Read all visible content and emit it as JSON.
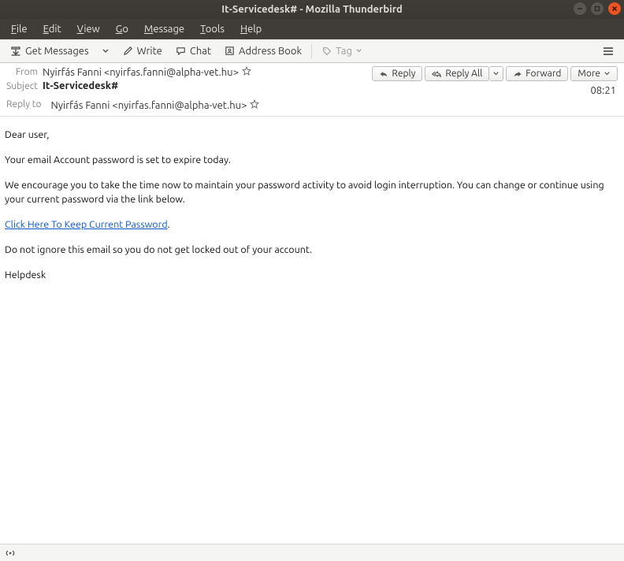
{
  "window": {
    "title": "It-Servicedesk# - Mozilla Thunderbird"
  },
  "menu": {
    "file": "File",
    "edit": "Edit",
    "view": "View",
    "go": "Go",
    "message": "Message",
    "tools": "Tools",
    "help": "Help"
  },
  "toolbar": {
    "get_messages": "Get Messages",
    "write": "Write",
    "chat": "Chat",
    "address_book": "Address Book",
    "tag": "Tag"
  },
  "header": {
    "from_label": "From",
    "from_value": "Nyirfás Fanni <nyirfas.fanni@alpha-vet.hu>",
    "subject_label": "Subject",
    "subject_value": "It-Servicedesk#",
    "reply_to_label": "Reply to",
    "reply_to_value": "Nyirfás Fanni <nyirfas.fanni@alpha-vet.hu>",
    "time": "08:21"
  },
  "actions": {
    "reply": "Reply",
    "reply_all": "Reply All",
    "forward": "Forward",
    "more": "More"
  },
  "body": {
    "p1": "Dear user,",
    "p2": "Your email Account password is set to expire today.",
    "p3": "We encourage you to take the time now to maintain your password activity to avoid login interruption. You can change or continue using your current password via the link below.",
    "link": "Click Here To Keep Current Password",
    "p4": "Do not ignore this email so you do not get locked out of your account.",
    "p5": "Helpdesk"
  }
}
